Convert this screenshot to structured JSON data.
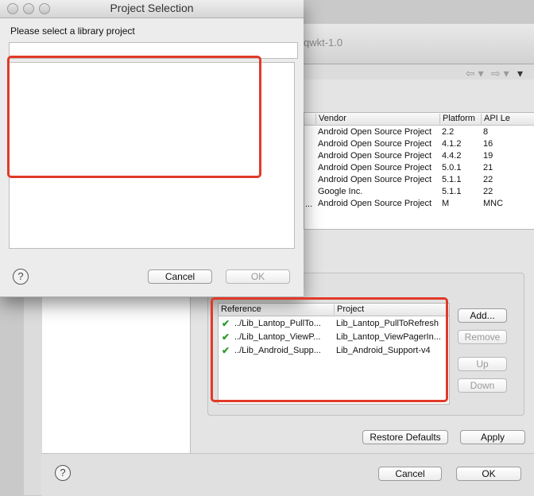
{
  "background_window": {
    "title": "qwkt-1.0",
    "nav_back": "⇦ ▾",
    "nav_forward": "⇨ ▾",
    "nav_menu": "▾"
  },
  "target_table": {
    "columns": [
      "Vendor",
      "Platform",
      "API Le"
    ],
    "rows": [
      [
        "Android Open Source Project",
        "2.2",
        "8"
      ],
      [
        "Android Open Source Project",
        "4.1.2",
        "16"
      ],
      [
        "Android Open Source Project",
        "4.4.2",
        "19"
      ],
      [
        "Android Open Source Project",
        "5.0.1",
        "21"
      ],
      [
        "Android Open Source Project",
        "5.1.1",
        "22"
      ],
      [
        "Google Inc.",
        "5.1.1",
        "22"
      ],
      [
        "Android Open Source Project",
        "M",
        "MNC"
      ]
    ],
    "partial_name_fragment": "..."
  },
  "library": {
    "columns": [
      "Reference",
      "Project"
    ],
    "rows": [
      {
        "reference": "../Lib_Lantop_PullTo...",
        "project": "Lib_Lantop_PullToRefresh"
      },
      {
        "reference": "../Lib_Lantop_ViewP...",
        "project": "Lib_Lantop_ViewPagerIn..."
      },
      {
        "reference": "../Lib_Android_Supp...",
        "project": "Lib_Android_Support-v4"
      }
    ],
    "buttons": {
      "add": "Add...",
      "remove": "Remove",
      "up": "Up",
      "down": "Down"
    }
  },
  "properties_footer": {
    "restore_defaults": "Restore Defaults",
    "apply": "Apply",
    "cancel": "Cancel",
    "ok": "OK",
    "help": "?"
  },
  "dialog": {
    "title": "Project Selection",
    "prompt": "Please select a library project",
    "filter_value": "",
    "cancel": "Cancel",
    "ok": "OK",
    "help": "?"
  },
  "colors": {
    "highlight": "#e03a28",
    "check": "#2e9b2e"
  }
}
